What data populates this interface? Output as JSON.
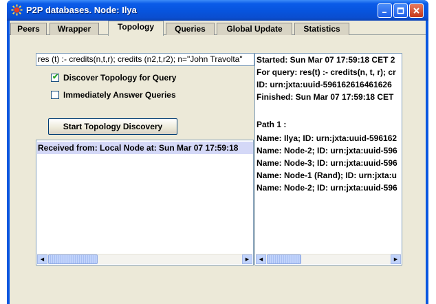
{
  "window": {
    "title": "P2P databases. Node: Ilya",
    "app_icon": "sun-icon",
    "controls": [
      "minimize-icon",
      "maximize-icon",
      "close-icon"
    ],
    "accent": "#0a57e0"
  },
  "tabs": [
    {
      "label": "Peers"
    },
    {
      "label": "Wrapper"
    },
    {
      "label": "Topology"
    },
    {
      "label": "Queries"
    },
    {
      "label": "Global Update"
    },
    {
      "label": "Statistics"
    }
  ],
  "active_tab": "Topology",
  "topology": {
    "query_value": "res (t) :- credits(n,t,r); credits (n2,t,r2); n=\"John Travolta\"",
    "discover_checkbox": {
      "label": "Discover Topology for Query",
      "checked": true
    },
    "answer_checkbox": {
      "label": "Immediately Answer Queries",
      "checked": false
    },
    "start_button": "Start Topology Discovery",
    "received_list": [
      "Received from: Local Node at: Sun Mar 07 17:59:18"
    ]
  },
  "details": {
    "lines": [
      "Started: Sun Mar 07 17:59:18 CET 2",
      "For query: res(t) :- credits(n, t, r); cr",
      "ID: urn:jxta:uuid-596162616461626",
      "Finished: Sun Mar 07 17:59:18 CET",
      "",
      "Path 1 :",
      "Name: Ilya; ID: urn:jxta:uuid-596162",
      "Name: Node-2; ID: urn:jxta:uuid-596",
      "Name: Node-3; ID: urn:jxta:uuid-596",
      "Name: Node-1 (Rand); ID: urn:jxta:u",
      "Name: Node-2; ID: urn:jxta:uuid-596"
    ]
  }
}
